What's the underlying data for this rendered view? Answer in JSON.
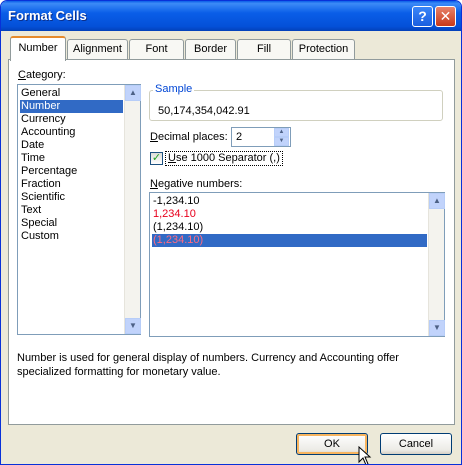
{
  "window": {
    "title": "Format Cells"
  },
  "titlebar": {
    "help_icon": "?",
    "close_icon": "✕"
  },
  "tabs": [
    {
      "label": "Number"
    },
    {
      "label": "Alignment"
    },
    {
      "label": "Font"
    },
    {
      "label": "Border"
    },
    {
      "label": "Fill"
    },
    {
      "label": "Protection"
    }
  ],
  "category": {
    "label_u": "C",
    "label_rest": "ategory:",
    "items": [
      "General",
      "Number",
      "Currency",
      "Accounting",
      "Date",
      "Time",
      "Percentage",
      "Fraction",
      "Scientific",
      "Text",
      "Special",
      "Custom"
    ],
    "selected": "Number"
  },
  "sample": {
    "legend": "Sample",
    "value": "50,174,354,042.91"
  },
  "decimal": {
    "label_u": "D",
    "label_rest": "ecimal places:",
    "value": "2"
  },
  "separator": {
    "checked": true,
    "label_u": "U",
    "label_rest": "se 1000 Separator (,)"
  },
  "negative": {
    "label_u": "N",
    "label_rest": "egative numbers:",
    "items": [
      {
        "text": "-1,234.10",
        "color": "#000000"
      },
      {
        "text": "1,234.10",
        "color": "#e8001c"
      },
      {
        "text": "(1,234.10)",
        "color": "#000000"
      },
      {
        "text": "(1,234.10)",
        "color": "#e8001c"
      }
    ],
    "selected_index": 3
  },
  "description": "Number is used for general display of numbers.  Currency and Accounting offer specialized formatting for monetary value.",
  "buttons": {
    "ok": "OK",
    "cancel": "Cancel"
  },
  "colors": {
    "selection": "#316ac5",
    "tab_accent": "#e68b2c",
    "title_blue": "#0a5ee8"
  }
}
